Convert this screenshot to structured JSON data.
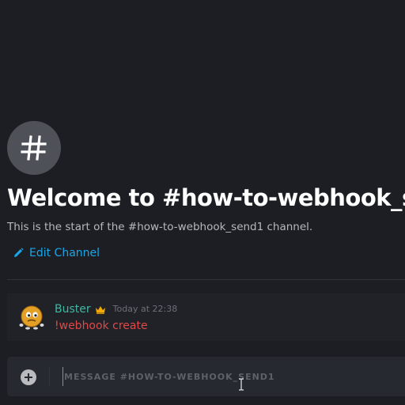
{
  "channel": {
    "icon": "hash-icon",
    "welcome_title": "Welcome to #how-to-webhook_send",
    "welcome_subtitle": "This is the start of the #how-to-webhook_send1 channel.",
    "edit_channel_label": "Edit Channel",
    "edit_icon": "pencil-icon"
  },
  "messages": [
    {
      "author": "Buster",
      "author_badge": "crown-icon",
      "timestamp": "Today at 22:38",
      "content": "!webhook create",
      "avatar": "avatar-icon"
    }
  ],
  "composer": {
    "add_icon": "plus-circle-icon",
    "placeholder": "MESSAGE #HOW-TO-WEBHOOK_SEND1",
    "value": ""
  },
  "colors": {
    "background": "#1c1e23",
    "accent_link": "#1ba6e8",
    "author_name": "#3fb8a1",
    "crown": "#f2a900",
    "message_text": "#e04848"
  }
}
